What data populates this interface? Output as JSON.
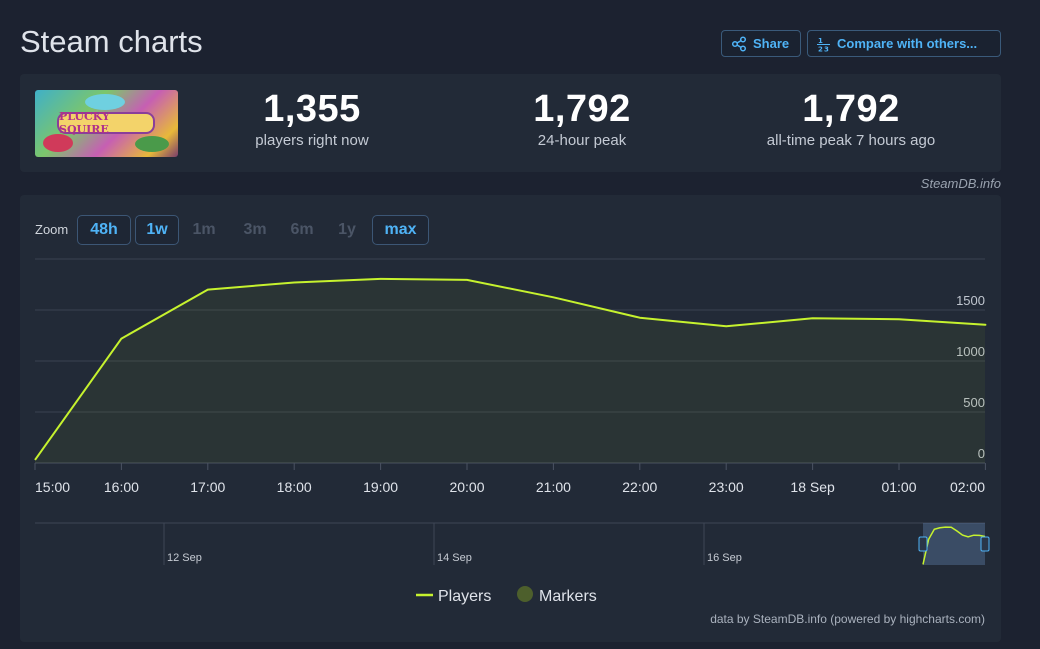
{
  "header": {
    "title": "Steam charts",
    "share_label": "Share",
    "compare_label": "Compare with others..."
  },
  "stats": {
    "game_logo_text": "PLUCKY SQUIRE",
    "players_now": "1,355",
    "players_now_label": "players right now",
    "peak_24h": "1,792",
    "peak_24h_label": "24-hour peak",
    "all_time_peak": "1,792",
    "all_time_peak_label": "all-time peak 7 hours ago"
  },
  "steamdb_credit": "SteamDB.info",
  "zoom": {
    "label": "Zoom",
    "buttons": [
      {
        "label": "48h",
        "state": "active"
      },
      {
        "label": "1w",
        "state": "active"
      },
      {
        "label": "1m",
        "state": "disabled"
      },
      {
        "label": "3m",
        "state": "disabled"
      },
      {
        "label": "6m",
        "state": "disabled"
      },
      {
        "label": "1y",
        "state": "disabled"
      },
      {
        "label": "max",
        "state": "active"
      }
    ]
  },
  "footer_credit": "data by SteamDB.info (powered by highcharts.com)",
  "colors": {
    "line": "#c6f22e",
    "marker": "#4d5f2c",
    "accent": "#4fb3f6",
    "grid": "#3a4251"
  },
  "chart_data": {
    "type": "line",
    "title": "",
    "xlabel": "",
    "ylabel": "",
    "x": [
      "15:00",
      "16:00",
      "17:00",
      "18:00",
      "19:00",
      "20:00",
      "21:00",
      "22:00",
      "23:00",
      "18 Sep",
      "01:00",
      "02:00"
    ],
    "series": [
      {
        "name": "Players",
        "values": [
          30,
          1220,
          1700,
          1770,
          1805,
          1795,
          1625,
          1425,
          1340,
          1420,
          1410,
          1355
        ]
      }
    ],
    "ylim": [
      0,
      2000
    ],
    "yticks": [
      0,
      500,
      1000,
      1500
    ],
    "grid": true,
    "legend": [
      {
        "name": "Players",
        "kind": "line"
      },
      {
        "name": "Markers",
        "kind": "dot"
      }
    ],
    "legend_position": "bottom-center",
    "navigator": {
      "labels": [
        "12 Sep",
        "14 Sep",
        "16 Sep"
      ]
    }
  }
}
